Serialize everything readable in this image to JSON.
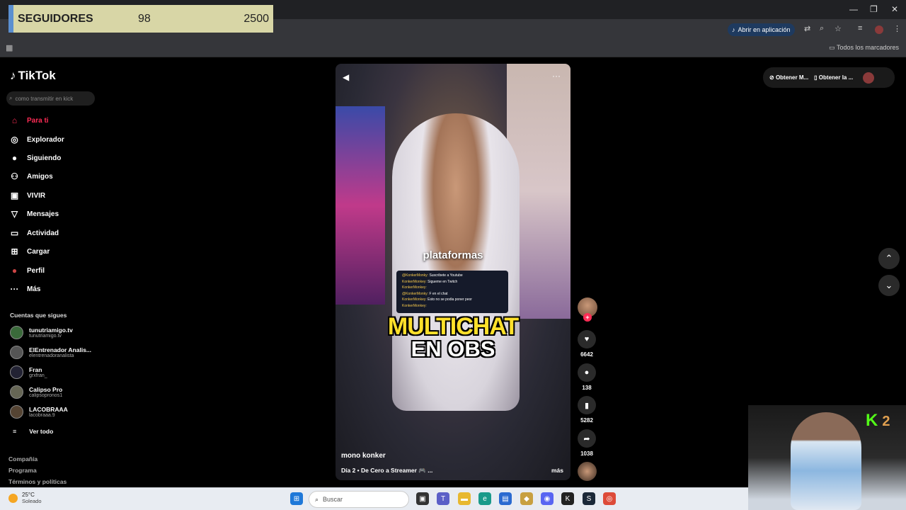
{
  "overlay": {
    "label": "SEGUIDORES",
    "current": "98",
    "goal": "2500"
  },
  "browser": {
    "open_app": "Abrir en aplicación",
    "bookmarks": "Todos los marcadores"
  },
  "sidebar": {
    "logo": "TikTok",
    "search_placeholder": "como transmitir en kick",
    "items": [
      {
        "label": "Para ti",
        "icon": "home-icon"
      },
      {
        "label": "Explorador",
        "icon": "compass-icon"
      },
      {
        "label": "Siguiendo",
        "icon": "following-avatar-icon"
      },
      {
        "label": "Amigos",
        "icon": "friends-icon"
      },
      {
        "label": "VIVIR",
        "icon": "live-icon"
      },
      {
        "label": "Mensajes",
        "icon": "send-icon"
      },
      {
        "label": "Actividad",
        "icon": "activity-icon"
      },
      {
        "label": "Cargar",
        "icon": "upload-icon"
      },
      {
        "label": "Perfil",
        "icon": "profile-icon"
      },
      {
        "label": "Más",
        "icon": "more-icon"
      }
    ],
    "following_title": "Cuentas que sigues",
    "following": [
      {
        "name": "tunutriamigo.tv",
        "handle": "tunutriamigo.tv"
      },
      {
        "name": "ElEntrenador Analis...",
        "handle": "elentrenadoranalista"
      },
      {
        "name": "Fran",
        "handle": "grxfran_"
      },
      {
        "name": "Calipso Pro",
        "handle": "calipsopronos1"
      },
      {
        "name": "LACOBRAAA",
        "handle": "lacobraaa.9"
      }
    ],
    "see_all": "Ver todo",
    "footer": [
      "Compañía",
      "Programa",
      "Términos y políticas"
    ]
  },
  "video": {
    "caption": "plataformas",
    "chat_lines": [
      {
        "user": "@KonkerMonky:",
        "text": "Suscribete a Youtube"
      },
      {
        "user": "KonkerMonkey:",
        "text": "Sigueme en Twitch"
      },
      {
        "user": "KonkerMonkey:",
        "text": ""
      },
      {
        "user": "@KonkerMonky:",
        "text": "F en el chat"
      },
      {
        "user": "KonkerMonkey:",
        "text": "Esto no se podia poner peor"
      },
      {
        "user": "KonkerMonkey:",
        "text": ""
      }
    ],
    "title_line1": "MULTICHAT",
    "title_line2": "EN OBS",
    "author": "mono konker",
    "description": "Día 2 • De Cero a Streamer 🎮 ...",
    "more": "más"
  },
  "actions": {
    "likes": "6642",
    "comments": "138",
    "saves": "5282",
    "shares": "1038"
  },
  "top_right": {
    "btn1": "Obtener M...",
    "btn2": "Obtener la ..."
  },
  "cam_overlay": {
    "number": "2"
  },
  "taskbar": {
    "temp": "25°C",
    "weather": "Soleado",
    "search": "Buscar"
  }
}
